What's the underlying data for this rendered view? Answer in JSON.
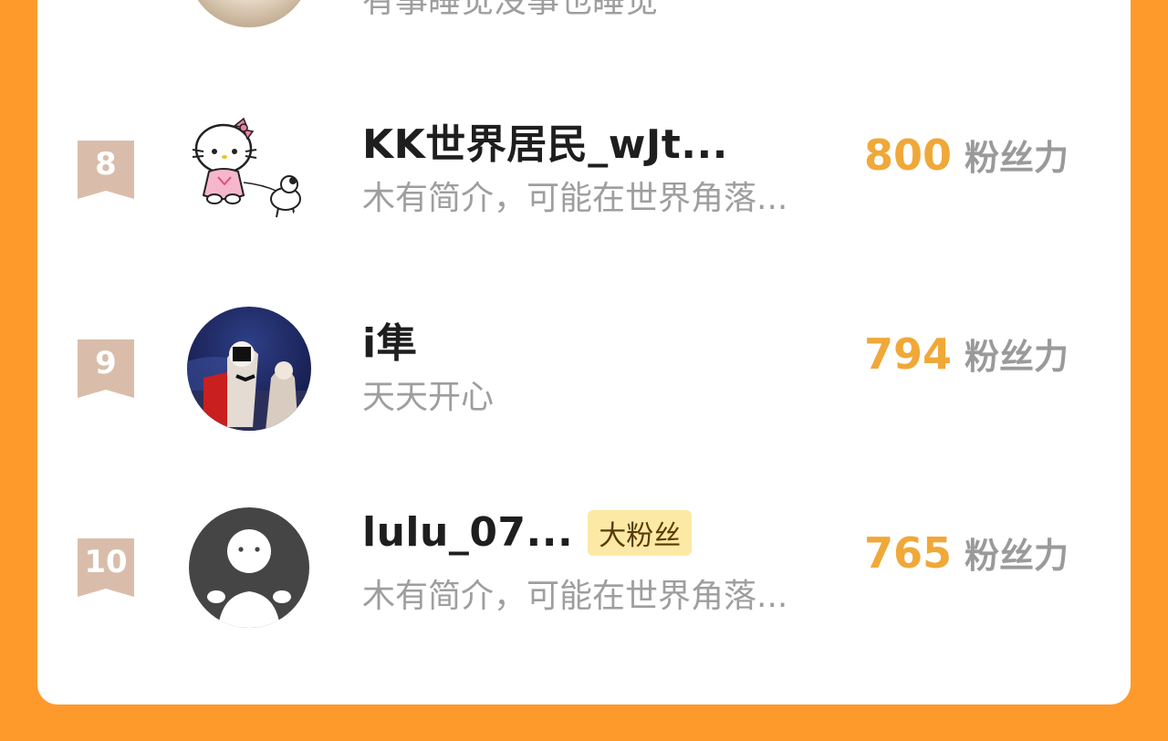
{
  "previous": {
    "bio": "有事睡觉没事也睡觉"
  },
  "rows": [
    {
      "rank": "8",
      "name": "KK世界居民_wJt...",
      "bio": "木有简介，可能在世界角落...",
      "score": "800",
      "unit": "粉丝力",
      "avatar": "hello-kitty-avatar"
    },
    {
      "rank": "9",
      "name": "i隼",
      "bio": "天天开心",
      "score": "794",
      "unit": "粉丝力",
      "avatar": "game-character-avatar"
    },
    {
      "rank": "10",
      "name": "lulu_07...",
      "badge": "大粉丝",
      "bio": "木有简介，可能在世界角落...",
      "score": "765",
      "unit": "粉丝力",
      "avatar": "default-avatar"
    }
  ],
  "colors": {
    "background": "#FE9A2C",
    "score": "#F0A838",
    "rank": "#D9BDAA"
  }
}
